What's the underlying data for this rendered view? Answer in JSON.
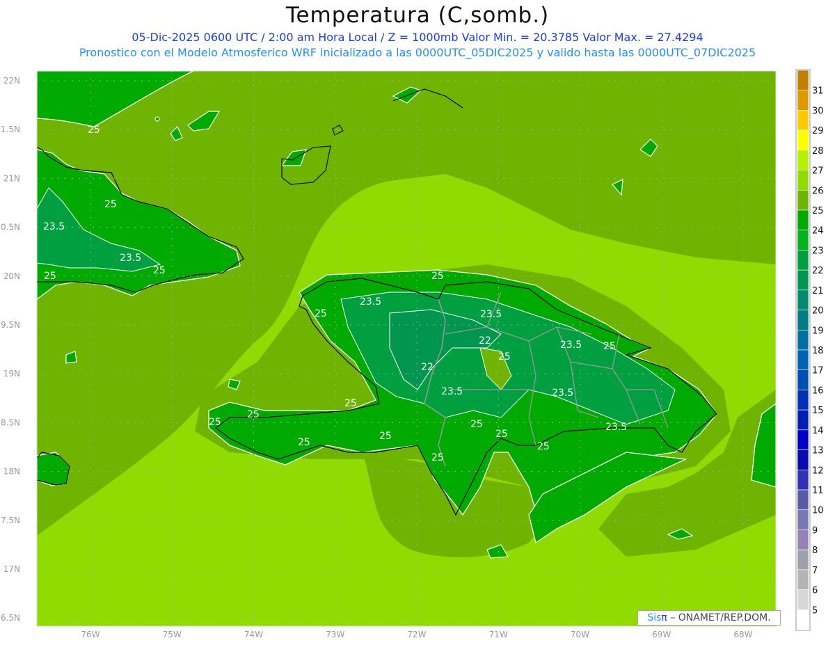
{
  "header": {
    "title": "Temperatura (C,somb.)",
    "subtitle": "05-Dic-2025  0600 UTC / 2:00 am Hora Local / Z = 1000mb   Valor Min. = 20.3785  Valor Max. = 27.4294",
    "model_line": "Pronostico con el Modelo Atmosferico WRF inicializado a las 0000UTC_05DIC2025 y valido hasta las  0000UTC_07DIC2025"
  },
  "map": {
    "lon_labels": [
      "76W",
      "75W",
      "74W",
      "73W",
      "72W",
      "71W",
      "70W",
      "69W",
      "68W"
    ],
    "lat_labels": [
      "22N",
      "1.5N",
      "21N",
      "0.5N",
      "20N",
      "9.5N",
      "19N",
      "8.5N",
      "18N",
      "7.5N",
      "17N",
      "6.5N"
    ],
    "contour_labels": [
      "25",
      "25",
      "23.5",
      "23.5",
      "25",
      "25",
      "25",
      "23.5",
      "23.5",
      "22",
      "22",
      "25",
      "23.5",
      "25",
      "23.5",
      "23.5",
      "25",
      "25",
      "25",
      "25",
      "25",
      "25",
      "25",
      "25",
      "25",
      "25",
      "23.5"
    ],
    "colors": {
      "ocean": "#6eb400",
      "warm_band": "#90dc00",
      "land": "#00aa00",
      "land_cool": "#00a040",
      "land_cooler": "#009650",
      "contour": "#ffffff",
      "coast": "#000000",
      "border": "#999999",
      "grid": "#aaaaaa"
    }
  },
  "colorbar": {
    "labels": [
      "31",
      "30",
      "29",
      "28",
      "27",
      "26",
      "25",
      "24",
      "23",
      "22",
      "21",
      "20",
      "19",
      "18",
      "17",
      "16",
      "15",
      "14",
      "13",
      "12",
      "11",
      "10",
      "9",
      "8",
      "7",
      "6",
      "5"
    ],
    "colors": [
      "#c08000",
      "#e09800",
      "#ffc800",
      "#ffff00",
      "#b4f000",
      "#90dc00",
      "#6eb400",
      "#00aa00",
      "#00b41e",
      "#00a040",
      "#009650",
      "#008a6e",
      "#007d82",
      "#0070a0",
      "#0064b4",
      "#0050b4",
      "#0032b4",
      "#001eb4",
      "#0000c8",
      "#0a0ab4",
      "#3232b4",
      "#5a5aaa",
      "#7878b4",
      "#9682b4",
      "#a0a0aa",
      "#b4b4b4",
      "#d7d7d7",
      "#ffffff"
    ]
  },
  "credit": {
    "sis": "Sis",
    "pi": "π",
    "rest": "– ONAMET/REP.DOM."
  }
}
